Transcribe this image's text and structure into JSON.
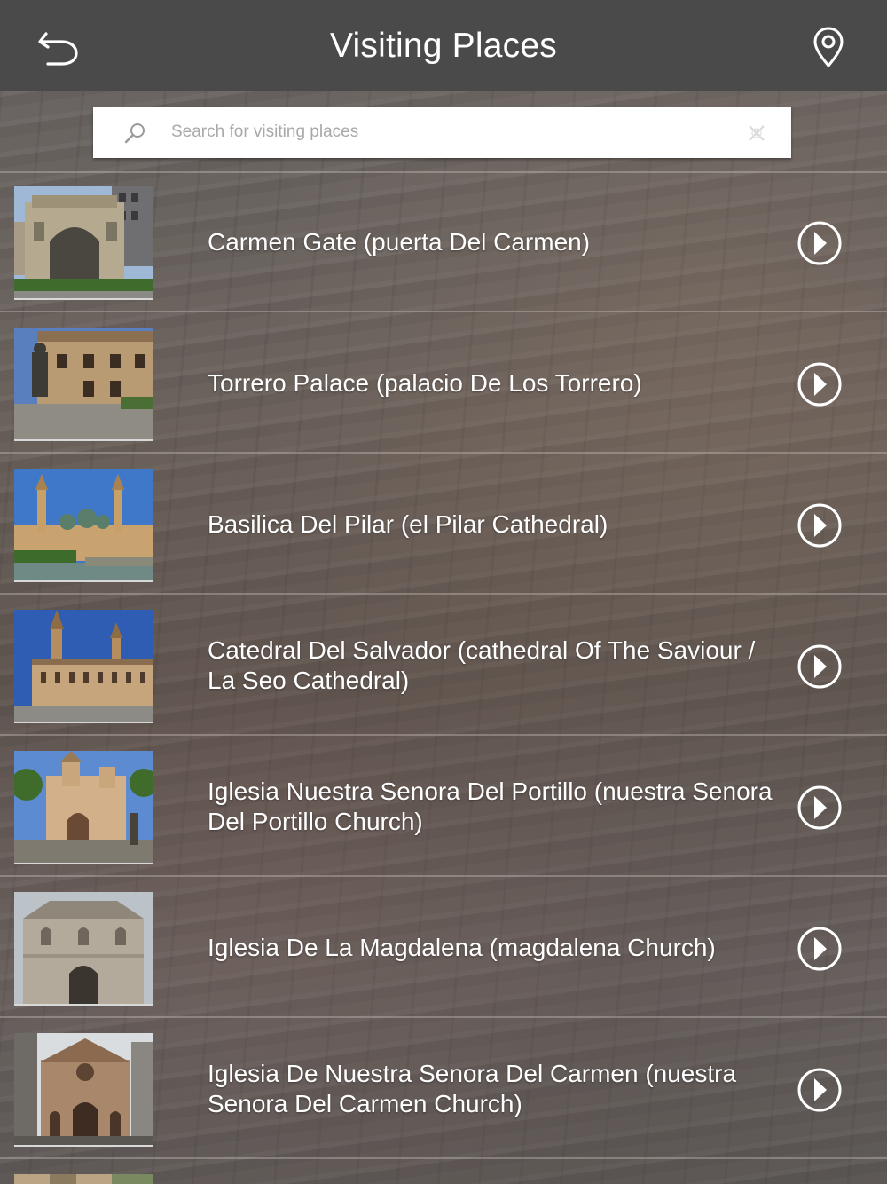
{
  "header": {
    "title": "Visiting Places",
    "back_icon": "back-arrow-icon",
    "location_icon": "map-pin-icon"
  },
  "search": {
    "placeholder": "Search for visiting places",
    "value": ""
  },
  "colors": {
    "header_bg": "#4a4a4a",
    "text": "#ffffff",
    "placeholder": "#a9a9a9"
  },
  "places": [
    {
      "name": "Carmen Gate (puerta Del Carmen)"
    },
    {
      "name": "Torrero Palace (palacio De Los Torrero)"
    },
    {
      "name": "Basilica Del Pilar (el Pilar Cathedral)"
    },
    {
      "name": "Catedral Del Salvador (cathedral Of The Saviour / La Seo Cathedral)"
    },
    {
      "name": "Iglesia Nuestra Senora Del Portillo (nuestra Senora Del Portillo Church)"
    },
    {
      "name": "Iglesia De La Magdalena (magdalena Church)"
    },
    {
      "name": "Iglesia De Nuestra Senora Del Carmen (nuestra Senora Del Carmen Church)"
    }
  ]
}
